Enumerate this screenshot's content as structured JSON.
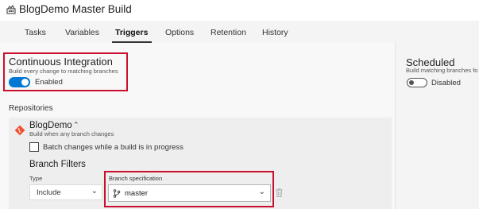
{
  "header": {
    "title": "BlogDemo Master Build",
    "icon": "build-definition-icon"
  },
  "tabs": [
    {
      "label": "Tasks",
      "active": false
    },
    {
      "label": "Variables",
      "active": false
    },
    {
      "label": "Triggers",
      "active": true
    },
    {
      "label": "Options",
      "active": false
    },
    {
      "label": "Retention",
      "active": false
    },
    {
      "label": "History",
      "active": false
    }
  ],
  "continuous_integration": {
    "title": "Continuous Integration",
    "subtitle": "Build every change to matching branches",
    "toggle_state": "Enabled",
    "enabled": true
  },
  "scheduled": {
    "title": "Scheduled",
    "subtitle": "Build matching branches fo",
    "toggle_state": "Disabled",
    "enabled": false
  },
  "repositories": {
    "label": "Repositories",
    "repo": {
      "name": "BlogDemo",
      "subtitle": "Build when any branch changes",
      "batch_label": "Batch changes while a build is in progress",
      "batch_checked": false
    }
  },
  "branch_filters": {
    "title": "Branch Filters",
    "type_label": "Type",
    "type_value": "Include",
    "spec_label": "Branch specification",
    "spec_value": "master"
  },
  "colors": {
    "accent": "#0078d4",
    "highlight": "#c8102e",
    "git": "#f05133"
  }
}
